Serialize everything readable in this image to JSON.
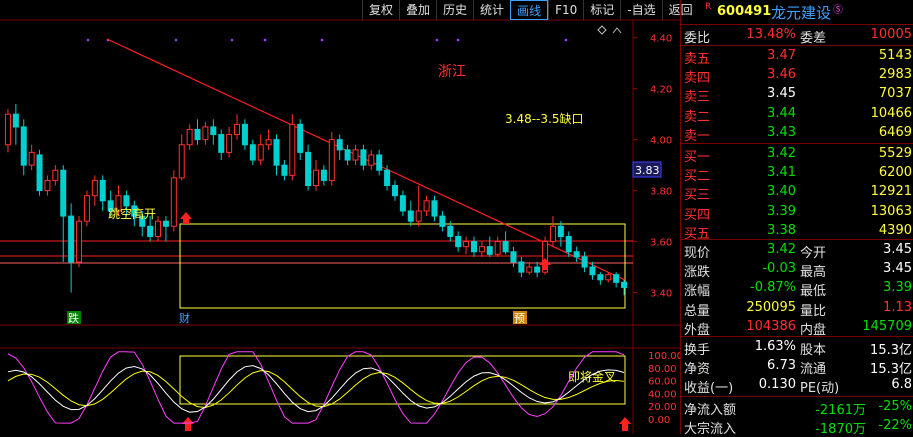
{
  "toolbar": [
    "复权",
    "叠加",
    "历史",
    "统计",
    "画线",
    "F10",
    "标记",
    "-自选",
    "返回"
  ],
  "toolbar_active": "画线",
  "stock": {
    "badge": "R",
    "code": "600491",
    "name": "龙元建设",
    "icon": "registered-icon"
  },
  "ratio": {
    "label": "委比",
    "value": "13.48%",
    "diff_label": "委差",
    "diff": "10005"
  },
  "asks": [
    {
      "label": "卖五",
      "price": "3.47",
      "vol": "5143"
    },
    {
      "label": "卖四",
      "price": "3.46",
      "vol": "2983"
    },
    {
      "label": "卖三",
      "price": "3.45",
      "vol": "7037"
    },
    {
      "label": "卖二",
      "price": "3.44",
      "vol": "10466"
    },
    {
      "label": "卖一",
      "price": "3.43",
      "vol": "6469"
    }
  ],
  "bids": [
    {
      "label": "买一",
      "price": "3.42",
      "vol": "5529"
    },
    {
      "label": "买二",
      "price": "3.41",
      "vol": "6200"
    },
    {
      "label": "买三",
      "price": "3.40",
      "vol": "12921"
    },
    {
      "label": "买四",
      "price": "3.39",
      "vol": "13063"
    },
    {
      "label": "买五",
      "price": "3.38",
      "vol": "4390"
    }
  ],
  "quote": [
    {
      "l1": "现价",
      "v1": "3.42",
      "l2": "今开",
      "v2": "3.45"
    },
    {
      "l1": "涨跌",
      "v1": "-0.03",
      "l2": "最高",
      "v2": "3.45"
    },
    {
      "l1": "涨幅",
      "v1": "-0.87%",
      "l2": "最低",
      "v2": "3.39"
    },
    {
      "l1": "总量",
      "v1": "250095",
      "l2": "量比",
      "v2": "1.13"
    },
    {
      "l1": "外盘",
      "v1": "104386",
      "l2": "内盘",
      "v2": "145709"
    }
  ],
  "stats": [
    {
      "l1": "换手",
      "v1": "1.63%",
      "l2": "股本",
      "v2": "15.3亿"
    },
    {
      "l1": "净资",
      "v1": "6.73",
      "l2": "流通",
      "v2": "15.3亿"
    },
    {
      "l1": "收益(一)",
      "v1": "0.130",
      "l2": "PE(动)",
      "v2": "6.8"
    }
  ],
  "flow": [
    {
      "label": "净流入额",
      "v1": "-2161万",
      "v2": "-25%"
    },
    {
      "label": "大宗流入",
      "v1": "-1870万",
      "v2": "-22%"
    }
  ],
  "annotations": {
    "region": "浙江",
    "gap": "3.48--3.5缺口",
    "jump": "跳空高开",
    "golden": "即将金叉"
  },
  "markers": [
    "跌",
    "财",
    "预"
  ],
  "price_axis": [
    "4.40",
    "4.20",
    "4.00",
    "3.80",
    "3.60",
    "3.40"
  ],
  "current_price_tag": "3.83",
  "osc_axis": [
    "100.00",
    "80.00",
    "60.00",
    "40.00",
    "20.00",
    "0.00"
  ],
  "colors": {
    "up": "#ff3030",
    "down": "#00d0d0",
    "trendline": "#ff2020",
    "box": "#ffff40",
    "osc_k": "#ffffff",
    "osc_d": "#ffff00",
    "osc_j": "#ff40ff"
  },
  "chart_data": {
    "type": "candlestick",
    "ylim": [
      3.3,
      4.45
    ],
    "candles": [
      [
        3.98,
        4.1,
        4.12,
        3.95
      ],
      [
        4.1,
        4.05,
        4.14,
        3.98
      ],
      [
        4.05,
        3.9,
        4.08,
        3.86
      ],
      [
        3.9,
        3.95,
        3.98,
        3.88
      ],
      [
        3.94,
        3.8,
        3.96,
        3.78
      ],
      [
        3.8,
        3.84,
        3.86,
        3.78
      ],
      [
        3.84,
        3.88,
        3.9,
        3.82
      ],
      [
        3.88,
        3.7,
        3.9,
        3.52
      ],
      [
        3.7,
        3.52,
        3.75,
        3.4
      ],
      [
        3.52,
        3.68,
        3.7,
        3.5
      ],
      [
        3.68,
        3.78,
        3.8,
        3.66
      ],
      [
        3.78,
        3.84,
        3.86,
        3.74
      ],
      [
        3.84,
        3.76,
        3.86,
        3.72
      ],
      [
        3.76,
        3.72,
        3.8,
        3.7
      ],
      [
        3.72,
        3.78,
        3.82,
        3.7
      ],
      [
        3.78,
        3.74,
        3.8,
        3.7
      ],
      [
        3.74,
        3.7,
        3.76,
        3.66
      ],
      [
        3.7,
        3.66,
        3.72,
        3.62
      ],
      [
        3.66,
        3.62,
        3.7,
        3.6
      ],
      [
        3.62,
        3.68,
        3.7,
        3.6
      ],
      [
        3.68,
        3.66,
        3.7,
        3.6
      ],
      [
        3.66,
        3.85,
        3.88,
        3.64
      ],
      [
        3.85,
        3.98,
        4.02,
        3.84
      ],
      [
        3.98,
        4.04,
        4.06,
        3.96
      ],
      [
        4.04,
        4.0,
        4.08,
        3.98
      ],
      [
        4.0,
        4.05,
        4.07,
        3.98
      ],
      [
        4.05,
        4.02,
        4.08,
        3.98
      ],
      [
        4.02,
        3.95,
        4.04,
        3.92
      ],
      [
        3.95,
        4.02,
        4.05,
        3.93
      ],
      [
        4.02,
        4.06,
        4.1,
        4.0
      ],
      [
        4.06,
        3.98,
        4.08,
        3.96
      ],
      [
        3.98,
        3.92,
        4.0,
        3.9
      ],
      [
        3.92,
        3.98,
        4.02,
        3.9
      ],
      [
        3.98,
        4.0,
        4.04,
        3.96
      ],
      [
        4.0,
        3.9,
        4.02,
        3.86
      ],
      [
        3.9,
        3.86,
        3.92,
        3.84
      ],
      [
        3.86,
        4.06,
        4.1,
        3.84
      ],
      [
        4.06,
        3.95,
        4.08,
        3.92
      ],
      [
        3.95,
        3.82,
        3.98,
        3.8
      ],
      [
        3.82,
        3.88,
        3.92,
        3.8
      ],
      [
        3.88,
        3.84,
        3.9,
        3.82
      ],
      [
        3.84,
        4.0,
        4.03,
        3.82
      ],
      [
        4.0,
        3.96,
        4.02,
        3.92
      ],
      [
        3.96,
        3.92,
        3.98,
        3.9
      ],
      [
        3.92,
        3.96,
        3.98,
        3.9
      ],
      [
        3.96,
        3.9,
        3.98,
        3.88
      ],
      [
        3.9,
        3.94,
        3.96,
        3.88
      ],
      [
        3.94,
        3.88,
        3.96,
        3.86
      ],
      [
        3.88,
        3.82,
        3.9,
        3.8
      ],
      [
        3.82,
        3.78,
        3.84,
        3.76
      ],
      [
        3.78,
        3.72,
        3.8,
        3.7
      ],
      [
        3.72,
        3.68,
        3.76,
        3.66
      ],
      [
        3.68,
        3.72,
        3.82,
        3.66
      ],
      [
        3.72,
        3.76,
        3.78,
        3.7
      ],
      [
        3.76,
        3.7,
        3.78,
        3.68
      ],
      [
        3.7,
        3.66,
        3.72,
        3.64
      ],
      [
        3.66,
        3.62,
        3.68,
        3.6
      ],
      [
        3.62,
        3.58,
        3.64,
        3.56
      ],
      [
        3.58,
        3.6,
        3.62,
        3.55
      ],
      [
        3.6,
        3.56,
        3.62,
        3.54
      ],
      [
        3.56,
        3.58,
        3.6,
        3.54
      ],
      [
        3.58,
        3.55,
        3.62,
        3.54
      ],
      [
        3.55,
        3.6,
        3.62,
        3.54
      ],
      [
        3.6,
        3.56,
        3.64,
        3.55
      ],
      [
        3.56,
        3.52,
        3.58,
        3.5
      ],
      [
        3.52,
        3.48,
        3.54,
        3.46
      ],
      [
        3.48,
        3.5,
        3.52,
        3.47
      ],
      [
        3.5,
        3.48,
        3.52,
        3.46
      ],
      [
        3.48,
        3.6,
        3.62,
        3.47
      ],
      [
        3.6,
        3.66,
        3.7,
        3.58
      ],
      [
        3.66,
        3.62,
        3.68,
        3.58
      ],
      [
        3.62,
        3.56,
        3.64,
        3.54
      ],
      [
        3.56,
        3.54,
        3.58,
        3.52
      ],
      [
        3.54,
        3.5,
        3.56,
        3.48
      ],
      [
        3.5,
        3.47,
        3.52,
        3.45
      ],
      [
        3.47,
        3.45,
        3.48,
        3.43
      ],
      [
        3.45,
        3.47,
        3.48,
        3.44
      ],
      [
        3.47,
        3.44,
        3.48,
        3.42
      ],
      [
        3.44,
        3.42,
        3.45,
        3.39
      ]
    ]
  }
}
